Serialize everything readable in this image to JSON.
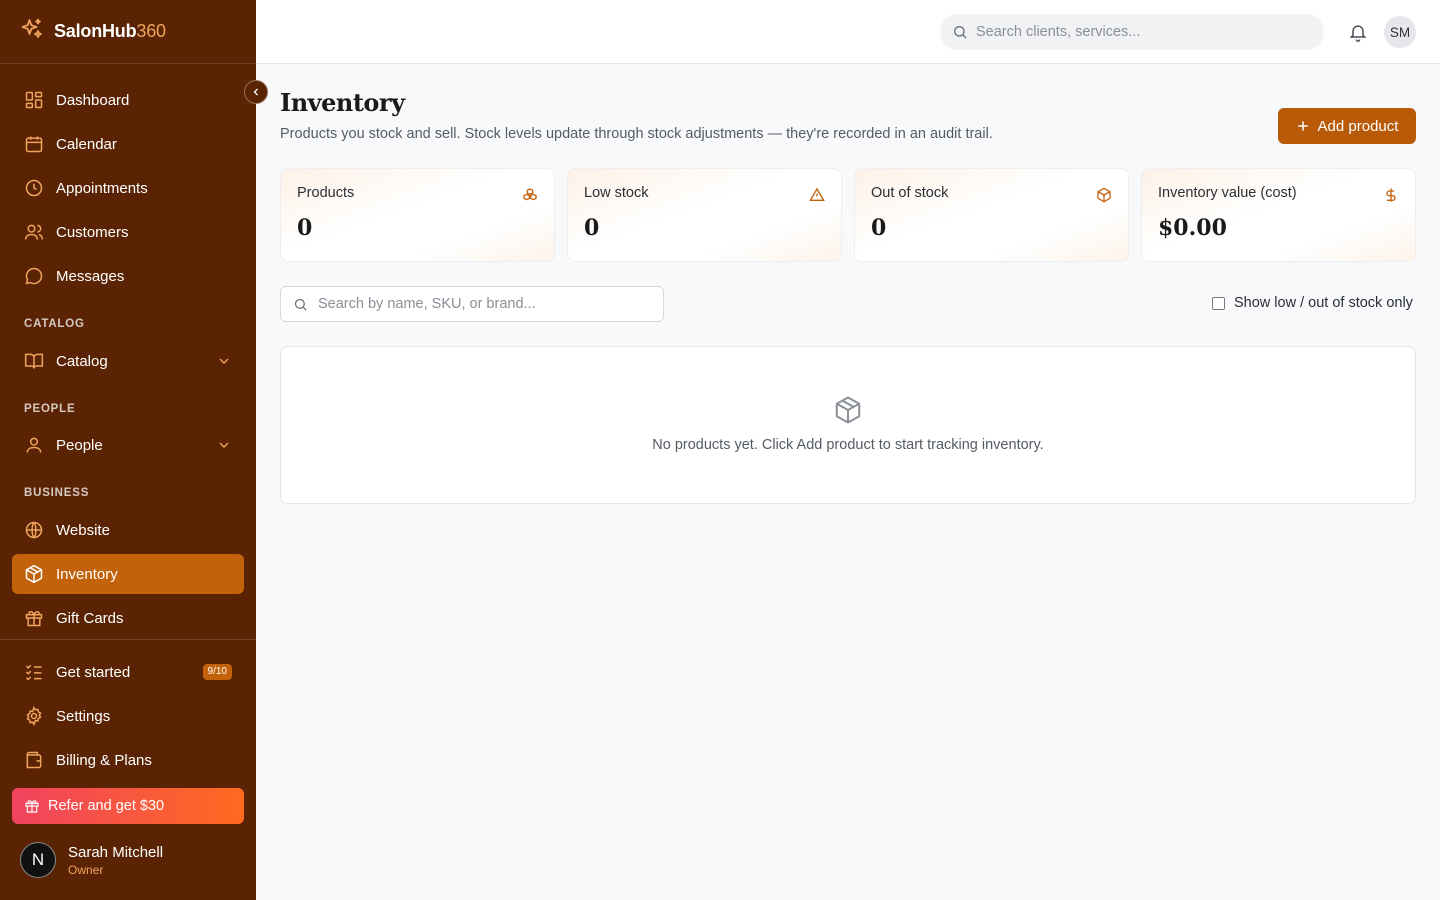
{
  "brand": {
    "name": "SalonHub",
    "suffix": "360"
  },
  "nav": {
    "dashboard": "Dashboard",
    "calendar": "Calendar",
    "appointments": "Appointments",
    "customers": "Customers",
    "messages": "Messages",
    "catalog_section": "CATALOG",
    "catalog": "Catalog",
    "people_section": "PEOPLE",
    "people": "People",
    "business_section": "BUSINESS",
    "website": "Website",
    "inventory": "Inventory",
    "gift_cards": "Gift Cards",
    "get_started": "Get started",
    "get_started_badge": "9/10",
    "settings": "Settings",
    "billing": "Billing & Plans"
  },
  "refer": {
    "label": "Refer and get $30"
  },
  "user": {
    "initial": "N",
    "name": "Sarah Mitchell",
    "role": "Owner"
  },
  "topbar": {
    "search_placeholder": "Search clients, services...",
    "avatar_initials": "SM"
  },
  "page": {
    "title": "Inventory",
    "subtitle": "Products you stock and sell. Stock levels update through stock adjustments — they're recorded in an audit trail.",
    "add_button": "Add product"
  },
  "stats": [
    {
      "label": "Products",
      "value": "0",
      "icon": "boxes-icon"
    },
    {
      "label": "Low stock",
      "value": "0",
      "icon": "warning-triangle-icon"
    },
    {
      "label": "Out of stock",
      "value": "0",
      "icon": "package-icon"
    },
    {
      "label": "Inventory value (cost)",
      "value": "$0.00",
      "icon": "dollar-icon"
    }
  ],
  "filters": {
    "search_placeholder": "Search by name, SKU, or brand...",
    "low_stock_only_label": "Show low / out of stock only",
    "low_stock_only_checked": false
  },
  "empty_state": {
    "message": "No products yet. Click Add product to start tracking inventory."
  },
  "colors": {
    "sidebar": "#5a2404",
    "accent": "#c2620b",
    "button": "#b85a07",
    "brand_accent": "#f0a35c"
  }
}
